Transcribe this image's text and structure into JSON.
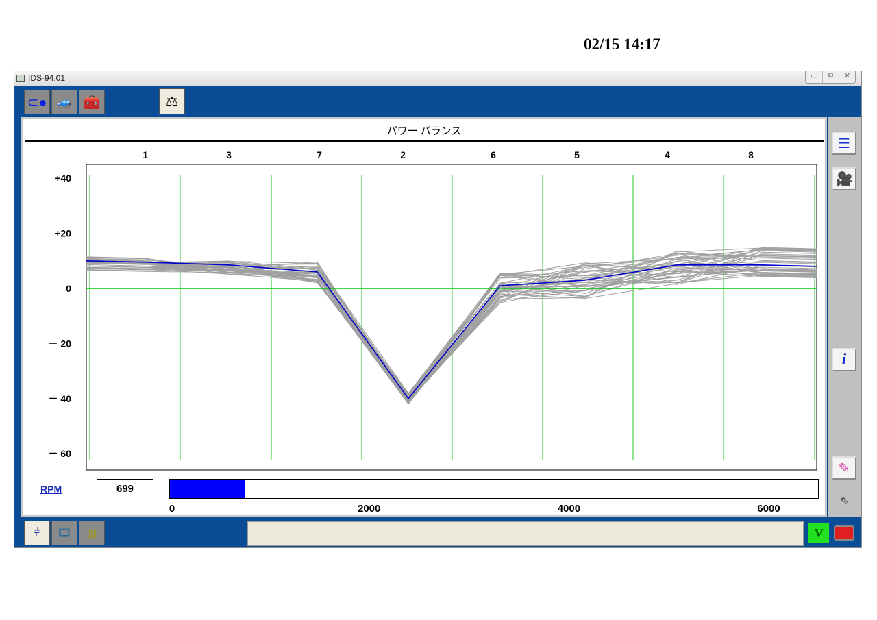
{
  "datetime": "02/15 14:17",
  "window": {
    "title": "IDS-94.01",
    "controls": [
      "▭",
      "⧉",
      "✕"
    ]
  },
  "top_tabs": [
    {
      "name": "connector",
      "icon": "connector-icon"
    },
    {
      "name": "vehicle",
      "icon": "car-icon"
    },
    {
      "name": "toolbox",
      "icon": "toolbox-icon"
    },
    {
      "name": "power-balance",
      "icon": "scale-icon"
    }
  ],
  "panel": {
    "title": "パワー バランス"
  },
  "side_buttons": [
    "list-icon",
    "camera-icon",
    "info-icon",
    "eraser-icon"
  ],
  "bottom_tabs": [
    "graph-icon",
    "film-icon",
    "abcd-icon"
  ],
  "status_icons": [
    "voltage-battery-icon",
    "battery-icon"
  ],
  "rpm": {
    "label": "RPM",
    "value": "699",
    "fill_fraction": 0.1165,
    "min": 0,
    "max": 6500,
    "ticks": [
      "0",
      "2000",
      "4000",
      "6000"
    ]
  },
  "chart_data": {
    "type": "line",
    "title": "パワー バランス",
    "categories": [
      "1",
      "3",
      "7",
      "2",
      "6",
      "5",
      "4",
      "8"
    ],
    "yticks": [
      "+40",
      "+20",
      "0",
      "－ 20",
      "－ 40",
      "－ 60"
    ],
    "ytick_values": [
      40,
      20,
      0,
      -20,
      -40,
      -60
    ],
    "ylim": [
      -66,
      51
    ],
    "series": [
      {
        "name": "current",
        "color": "#0000cc",
        "values": [
          9.5,
          8.5,
          6,
          -40,
          1,
          3,
          8.5,
          8.5
        ]
      }
    ],
    "history_range": {
      "color": "#a0a0a0",
      "min": [
        6,
        5,
        2,
        -42,
        -6,
        -4,
        1,
        4
      ],
      "max": [
        12,
        10,
        10,
        -38,
        6,
        10,
        14,
        15
      ]
    },
    "zero_line_color": "#00cc00",
    "grid": "vertical-green"
  }
}
